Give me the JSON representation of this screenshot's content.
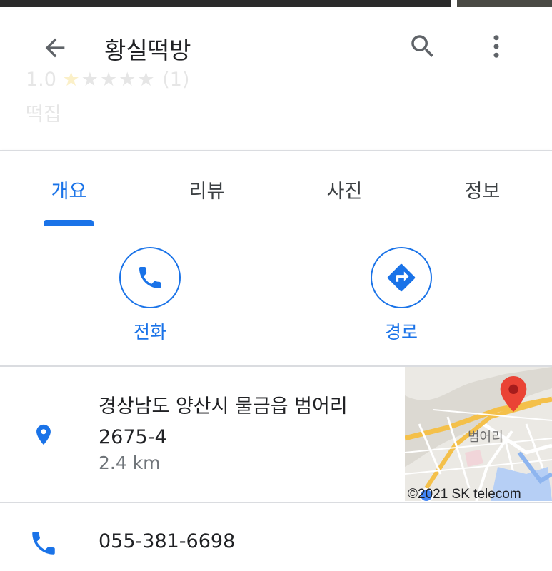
{
  "header": {
    "title": "황실떡방",
    "rating": "1.0",
    "stars": "★★★★★",
    "review_count": "(1)",
    "category": "떡집"
  },
  "tabs": [
    {
      "label": "개요",
      "active": true
    },
    {
      "label": "리뷰",
      "active": false
    },
    {
      "label": "사진",
      "active": false
    },
    {
      "label": "정보",
      "active": false
    }
  ],
  "actions": {
    "call_label": "전화",
    "directions_label": "경로"
  },
  "address": {
    "line1": "경상남도 양산시 물금읍 범어리",
    "line2": "2675-4",
    "distance": "2.4 km"
  },
  "map": {
    "place_label": "범어리",
    "copyright": "©2021 SK telecom"
  },
  "phone": {
    "number": "055-381-6698"
  },
  "colors": {
    "accent": "#1a73e8",
    "pin_red": "#ea4335",
    "text_primary": "#202124",
    "text_secondary": "#70757a"
  },
  "icons": {
    "back": "arrow-back-icon",
    "search": "search-icon",
    "more": "more-vert-icon",
    "call": "phone-icon",
    "directions": "directions-icon",
    "location": "location-pin-icon"
  }
}
